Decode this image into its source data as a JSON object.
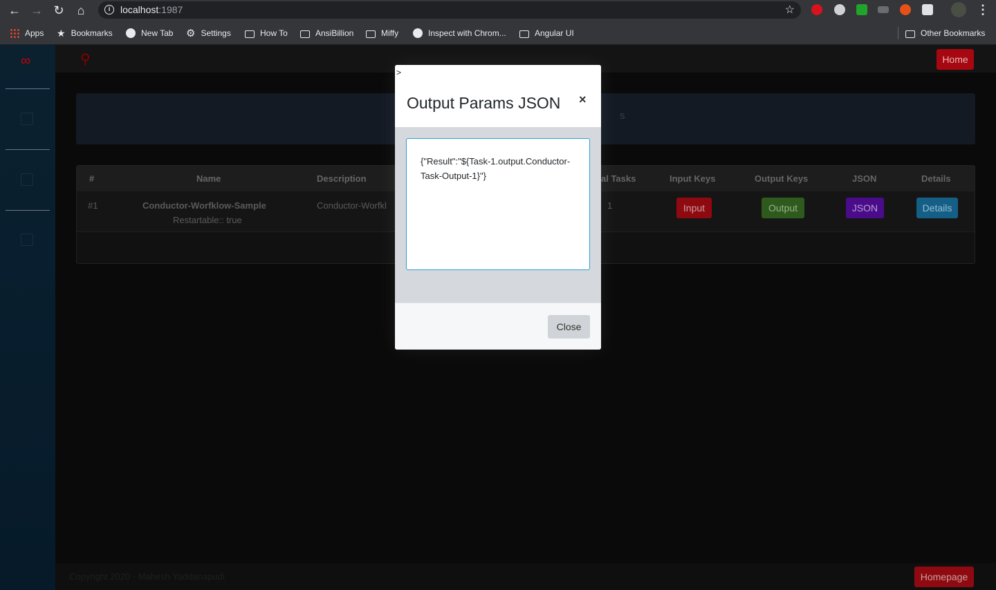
{
  "browser": {
    "url_host": "localhost",
    "url_port": ":1987",
    "bookmarks": [
      {
        "label": "Apps",
        "icon": "apps-grid-icon"
      },
      {
        "label": "Bookmarks",
        "icon": "star-icon"
      },
      {
        "label": "New Tab",
        "icon": "globe-icon"
      },
      {
        "label": "Settings",
        "icon": "gear-icon"
      },
      {
        "label": "How To",
        "icon": "folder-icon"
      },
      {
        "label": "AnsiBillion",
        "icon": "folder-icon"
      },
      {
        "label": "Miffy",
        "icon": "folder-icon"
      },
      {
        "label": "Inspect with Chrom...",
        "icon": "globe-icon"
      },
      {
        "label": "Angular UI",
        "icon": "folder-icon"
      }
    ],
    "other_bookmarks": "Other Bookmarks"
  },
  "app": {
    "home_label": "Home",
    "banner_text": "s",
    "table": {
      "headers": [
        "#",
        "Name",
        "Description",
        "al Tasks",
        "Input Keys",
        "Output Keys",
        "JSON",
        "Details"
      ],
      "rows": [
        {
          "index": "#1",
          "name": "Conductor-Worfklow-Sample",
          "restartable": "Restartable:: true",
          "description": "Conductor-Worfkl",
          "tasks": "1",
          "input_label": "Input",
          "output_label": "Output",
          "json_label": "JSON",
          "details_label": "Details"
        }
      ]
    },
    "footer_text": "Copyright 2020 - Mahesh Yaddanapudi",
    "homepage_label": "Homepage"
  },
  "modal": {
    "caret": ">",
    "title": "Output Params JSON",
    "close_x": "×",
    "json_value": "{\"Result\":\"${Task-1.output.Conductor-Task-Output-1}\"}",
    "close_label": "Close"
  },
  "colors": {
    "danger": "#a70710",
    "success": "#3f7a27",
    "purple": "#5b0fa8",
    "info": "#1a77a8",
    "focus_border": "#2f9ed9"
  }
}
